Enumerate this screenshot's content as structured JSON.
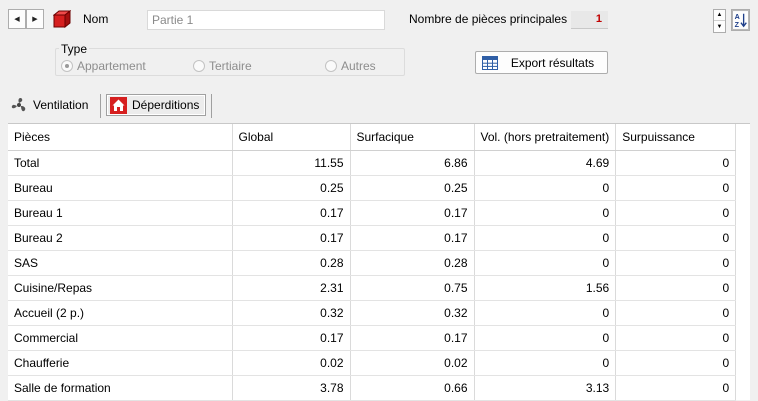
{
  "header": {
    "name_label": "Nom",
    "name_value": "Partie 1",
    "count_label": "Nombre de pièces principales",
    "count_value": "1"
  },
  "type_group": {
    "title": "Type",
    "options": [
      "Appartement",
      "Tertiaire",
      "Autres"
    ],
    "selected": "Appartement"
  },
  "export_button": {
    "label": "Export résultats",
    "icon": "table-icon"
  },
  "tabs": [
    {
      "label": "Ventilation",
      "icon": "fan-icon",
      "active": false
    },
    {
      "label": "Déperditions",
      "icon": "house-icon",
      "active": true
    }
  ],
  "table": {
    "columns": [
      "Pièces",
      "Global",
      "Surfacique",
      "Vol. (hors pretraitement)",
      "Surpuissance"
    ],
    "rows": [
      [
        "Total",
        "11.55",
        "6.86",
        "4.69",
        "0"
      ],
      [
        "Bureau",
        "0.25",
        "0.25",
        "0",
        "0"
      ],
      [
        "Bureau 1",
        "0.17",
        "0.17",
        "0",
        "0"
      ],
      [
        "Bureau 2",
        "0.17",
        "0.17",
        "0",
        "0"
      ],
      [
        "SAS",
        "0.28",
        "0.28",
        "0",
        "0"
      ],
      [
        "Cuisine/Repas",
        "2.31",
        "0.75",
        "1.56",
        "0"
      ],
      [
        "Accueil (2 p.)",
        "0.32",
        "0.32",
        "0",
        "0"
      ],
      [
        "Commercial",
        "0.17",
        "0.17",
        "0",
        "0"
      ],
      [
        "Chaufferie",
        "0.02",
        "0.02",
        "0",
        "0"
      ],
      [
        "Salle de formation",
        "3.78",
        "0.66",
        "3.13",
        "0"
      ]
    ]
  },
  "colors": {
    "accent_red": "#d61f1f",
    "count_red": "#c00000"
  }
}
